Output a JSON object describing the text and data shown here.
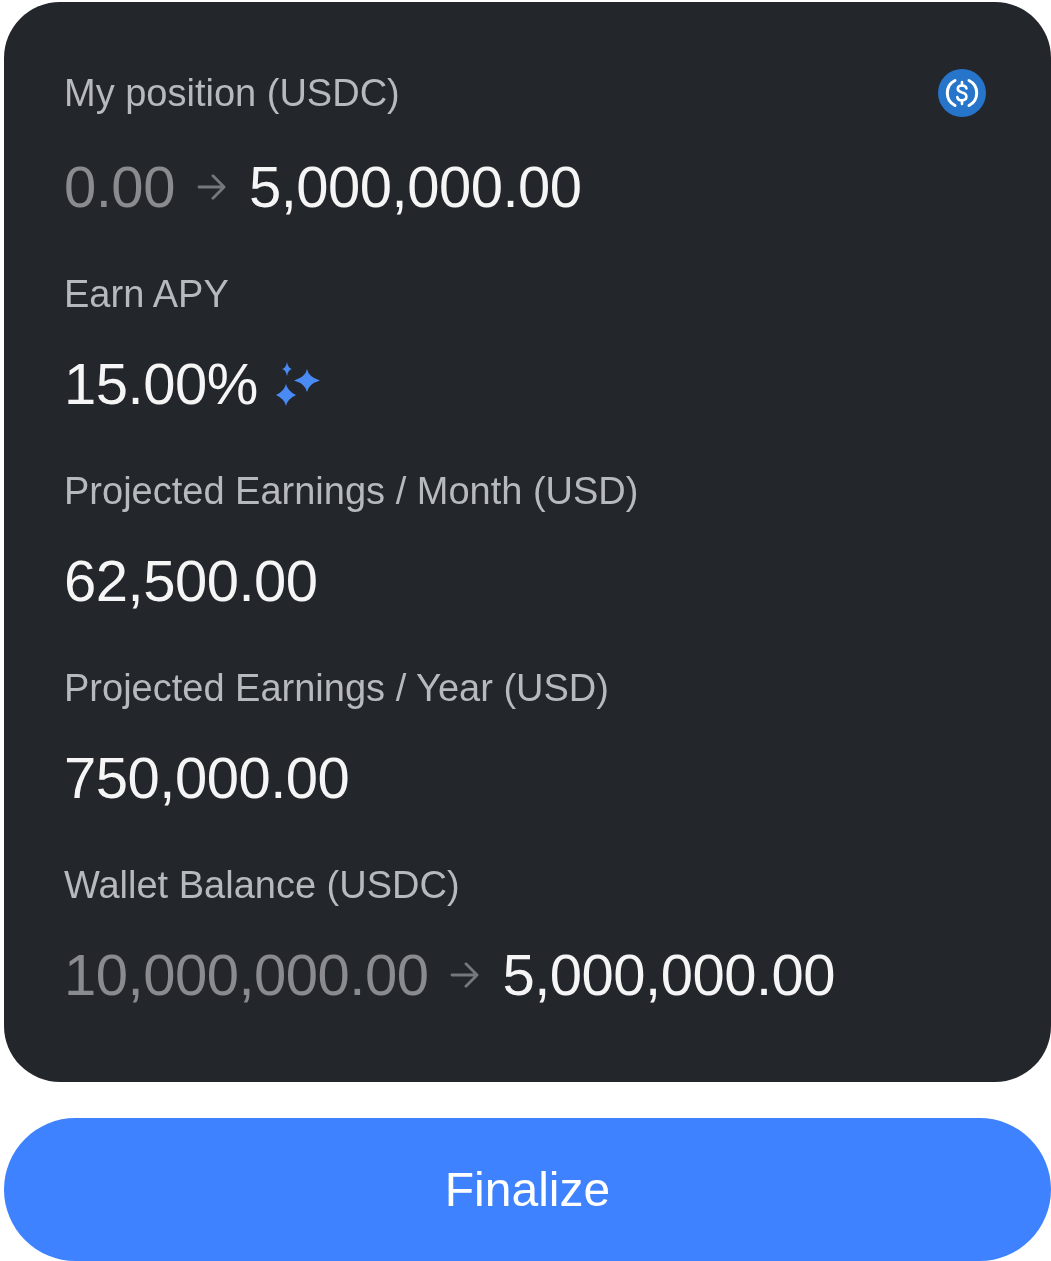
{
  "stats": [
    {
      "kind": "change",
      "label": "My position (USDC)",
      "from": "0.00",
      "to": "5,000,000.00"
    },
    {
      "kind": "boosted",
      "label": "Earn APY",
      "value": "15.00%"
    },
    {
      "kind": "value",
      "label": "Projected Earnings / Month (USD)",
      "value": "62,500.00"
    },
    {
      "kind": "value",
      "label": "Projected Earnings / Year (USD)",
      "value": "750,000.00"
    },
    {
      "kind": "change",
      "label": "Wallet Balance (USDC)",
      "from": "10,000,000.00",
      "to": "5,000,000.00"
    }
  ],
  "button": {
    "label": "Finalize"
  }
}
